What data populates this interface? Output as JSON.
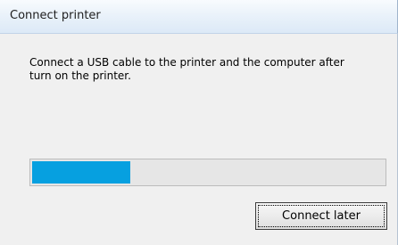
{
  "window": {
    "title": "Connect printer"
  },
  "dialog": {
    "message": "Connect a USB cable to the printer and the computer after\nturn on  the printer.",
    "progress": {
      "fraction": 0.28,
      "fill_color": "#06a0e0"
    },
    "buttons": {
      "connect_later_label": "Connect later"
    }
  }
}
